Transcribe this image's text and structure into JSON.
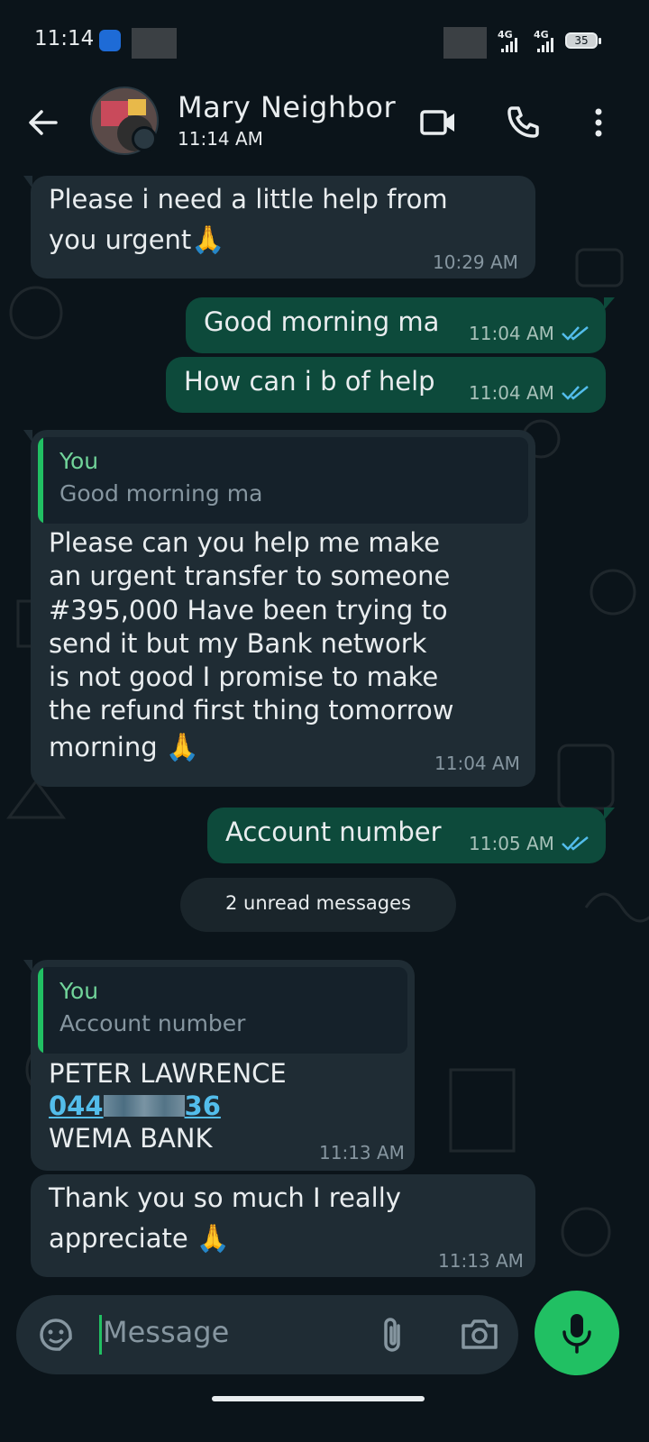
{
  "status_bar": {
    "time": "11:14",
    "network1": "4G",
    "network2": "4G",
    "battery": "35"
  },
  "header": {
    "contact_name": "Mary Neighbor",
    "last_seen": "11:14 AM"
  },
  "messages": [
    {
      "dir": "in",
      "text_lines": [
        "Please i need a little help from",
        "you urgent"
      ],
      "emoji": "🙏",
      "time": "10:29 AM"
    },
    {
      "dir": "out",
      "text": "Good morning ma",
      "time": "11:04 AM"
    },
    {
      "dir": "out",
      "text": "How can i b of help",
      "time": "11:04 AM"
    },
    {
      "dir": "in",
      "quote_author": "You",
      "quote_text": "Good morning ma",
      "text_lines": [
        "Please can you help me make",
        "an urgent transfer to someone",
        "#395,000 Have been trying to",
        "send it but my Bank network",
        "is not good I promise to make",
        "the refund first thing tomorrow",
        "morning"
      ],
      "emoji": "🙏",
      "time": "11:04 AM"
    },
    {
      "dir": "out",
      "text": "Account number",
      "time": "11:05 AM"
    },
    {
      "dir": "in",
      "quote_author": "You",
      "quote_text": "Account number",
      "name": "PETER LAWRENCE",
      "account_prefix": "044",
      "account_suffix": "36",
      "bank": "WEMA BANK",
      "time": "11:13 AM"
    },
    {
      "dir": "in",
      "text_lines": [
        "Thank you so much I really",
        "appreciate"
      ],
      "emoji": "🙏",
      "time": "11:13 AM"
    }
  ],
  "unread_banner": "2 unread messages",
  "input": {
    "placeholder": "Message"
  },
  "colors": {
    "background": "#0b141a",
    "incoming": "#1f2c34",
    "outgoing": "#0d4a3b",
    "accent": "#21c063",
    "link": "#53bdeb",
    "read_ticks": "#53bdeb"
  },
  "icons": [
    "back-arrow-icon",
    "video-call-icon",
    "phone-icon",
    "more-vert-icon",
    "sticker-icon",
    "attach-icon",
    "camera-icon",
    "mic-icon",
    "double-check-icon"
  ]
}
